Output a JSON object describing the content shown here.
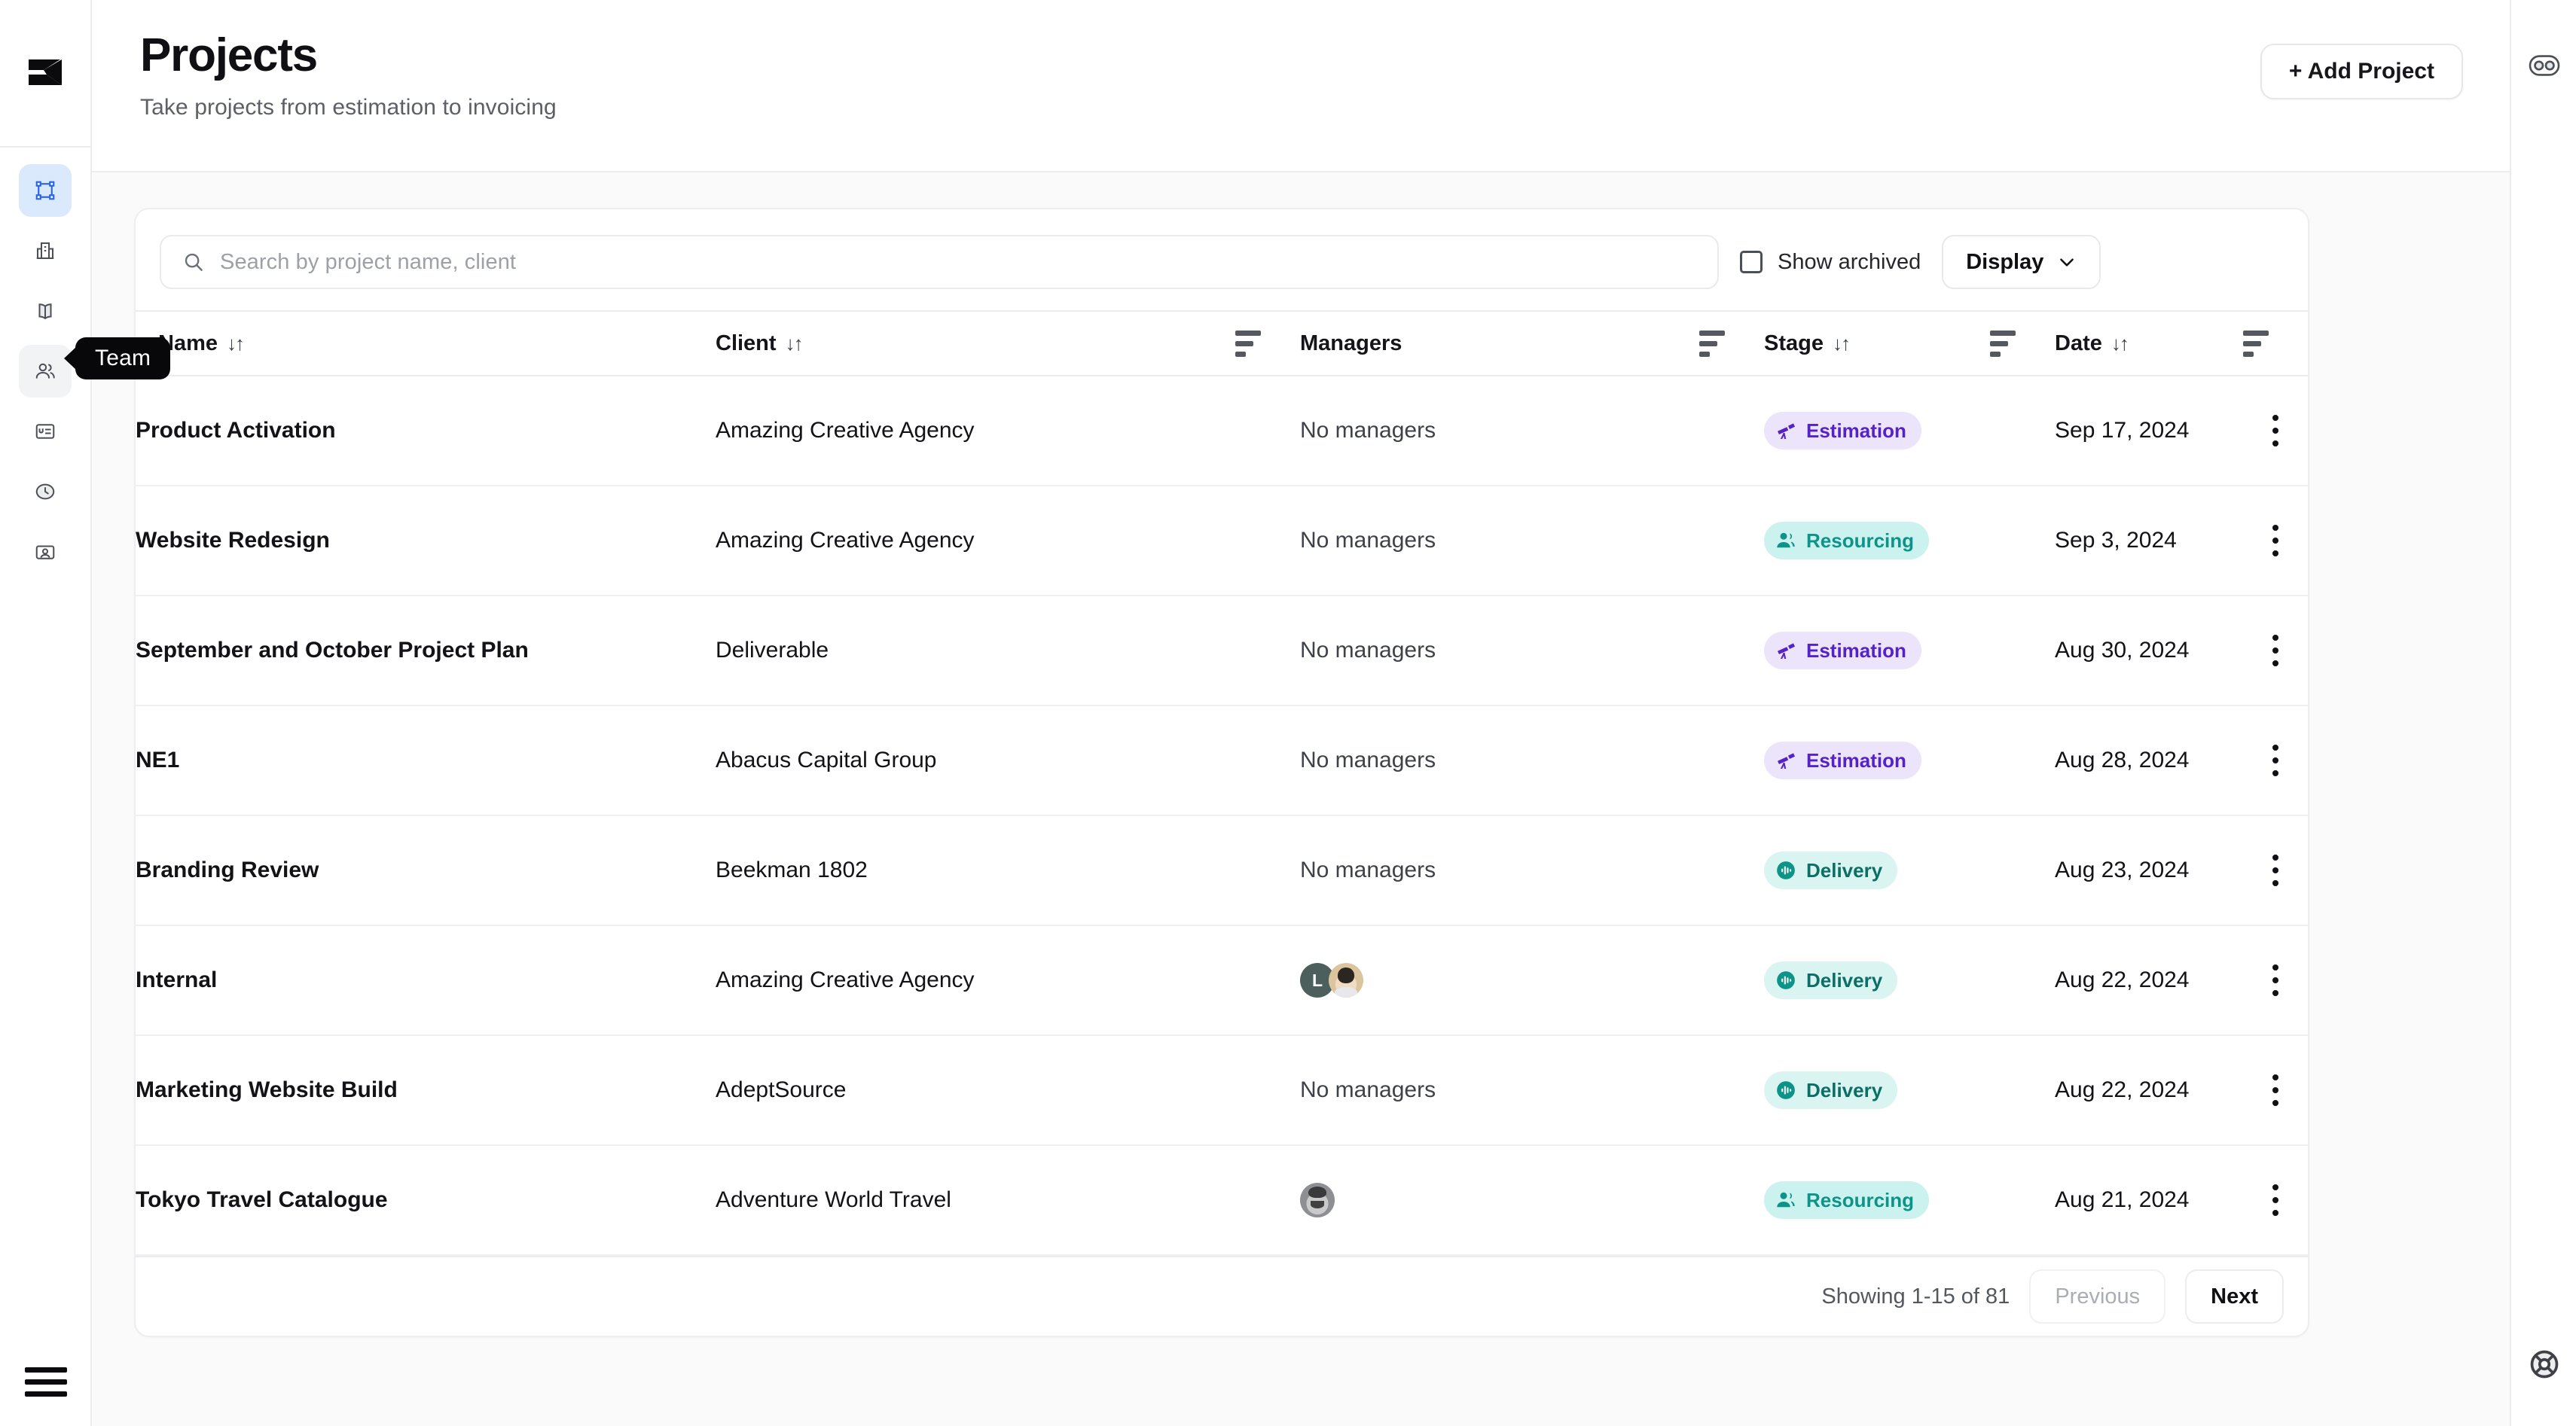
{
  "app": {
    "logo_icon": "logo-flag-icon"
  },
  "sidebar": {
    "items": [
      {
        "id": "projects",
        "icon": "frame-selection-icon",
        "label": "Projects",
        "active": true,
        "hovered": false
      },
      {
        "id": "clients",
        "icon": "building-icon",
        "label": "Clients",
        "active": false,
        "hovered": false
      },
      {
        "id": "library",
        "icon": "book-open-icon",
        "label": "Library",
        "active": false,
        "hovered": false
      },
      {
        "id": "team",
        "icon": "people-icon",
        "label": "Team",
        "active": false,
        "hovered": true
      },
      {
        "id": "invoices",
        "icon": "invoice-icon",
        "label": "Invoices",
        "active": false,
        "hovered": false
      },
      {
        "id": "time",
        "icon": "clock-icon",
        "label": "Time",
        "active": false,
        "hovered": false
      },
      {
        "id": "account",
        "icon": "id-card-icon",
        "label": "Account",
        "active": false,
        "hovered": false
      }
    ],
    "tooltip": "Team",
    "menu_icon": "hamburger-menu-icon"
  },
  "header": {
    "title": "Projects",
    "subtitle": "Take projects from estimation to invoicing",
    "add_button": "+ Add Project"
  },
  "right_rail": {
    "top_icon": "toggle-switch-icon",
    "bottom_icon": "lifebuoy-help-icon"
  },
  "toolbar": {
    "search_placeholder": "Search by project name, client",
    "search_value": "",
    "search_icon": "search-icon",
    "show_archived_label": "Show archived",
    "show_archived_checked": false,
    "display_label": "Display",
    "display_chevron_icon": "chevron-down-icon"
  },
  "table": {
    "columns": [
      {
        "key": "name",
        "label": "Name",
        "sortable": true,
        "filterable": false
      },
      {
        "key": "client",
        "label": "Client",
        "sortable": true,
        "filterable": true
      },
      {
        "key": "managers",
        "label": "Managers",
        "sortable": false,
        "filterable": true
      },
      {
        "key": "stage",
        "label": "Stage",
        "sortable": true,
        "filterable": true
      },
      {
        "key": "date",
        "label": "Date",
        "sortable": true,
        "filterable": true
      }
    ],
    "sort_icon": "sort-arrows-icon",
    "filter_icon": "filter-icon",
    "row_menu_icon": "kebab-menu-icon",
    "no_managers_text": "No managers",
    "rows": [
      {
        "name": "Product Activation",
        "client": "Amazing Creative Agency",
        "managers": [],
        "stage": "Estimation",
        "stage_type": "estimation",
        "date": "Sep 17, 2024"
      },
      {
        "name": "Website Redesign",
        "client": "Amazing Creative Agency",
        "managers": [],
        "stage": "Resourcing",
        "stage_type": "resourcing",
        "date": "Sep 3, 2024"
      },
      {
        "name": "September and October Project Plan",
        "client": "Deliverable",
        "managers": [],
        "stage": "Estimation",
        "stage_type": "estimation",
        "date": "Aug 30, 2024"
      },
      {
        "name": "NE1",
        "client": "Abacus Capital Group",
        "managers": [],
        "stage": "Estimation",
        "stage_type": "estimation",
        "date": "Aug 28, 2024"
      },
      {
        "name": "Branding Review",
        "client": "Beekman 1802",
        "managers": [],
        "stage": "Delivery",
        "stage_type": "delivery",
        "date": "Aug 23, 2024"
      },
      {
        "name": "Internal",
        "client": "Amazing Creative Agency",
        "managers": [
          {
            "type": "initial",
            "initial": "L"
          },
          {
            "type": "photo-a",
            "initial": ""
          }
        ],
        "stage": "Delivery",
        "stage_type": "delivery",
        "date": "Aug 22, 2024"
      },
      {
        "name": "Marketing Website Build",
        "client": "AdeptSource",
        "managers": [],
        "stage": "Delivery",
        "stage_type": "delivery",
        "date": "Aug 22, 2024"
      },
      {
        "name": "Tokyo Travel Catalogue",
        "client": "Adventure World Travel",
        "managers": [
          {
            "type": "photo-b",
            "initial": ""
          }
        ],
        "stage": "Resourcing",
        "stage_type": "resourcing",
        "date": "Aug 21, 2024"
      }
    ]
  },
  "pagination": {
    "showing": "Showing 1-15 of 81",
    "previous": "Previous",
    "next": "Next",
    "previous_disabled": true
  },
  "colors": {
    "accent_blue": "#2563eb",
    "estimation_bg": "#ece4fb",
    "estimation_fg": "#5521c9",
    "resourcing_bg": "#ccf2ef",
    "resourcing_fg": "#0d9488",
    "delivery_bg": "#d9f4f1",
    "delivery_fg": "#0b6f66",
    "page_bg": "#fafafa",
    "border": "#ececee"
  }
}
